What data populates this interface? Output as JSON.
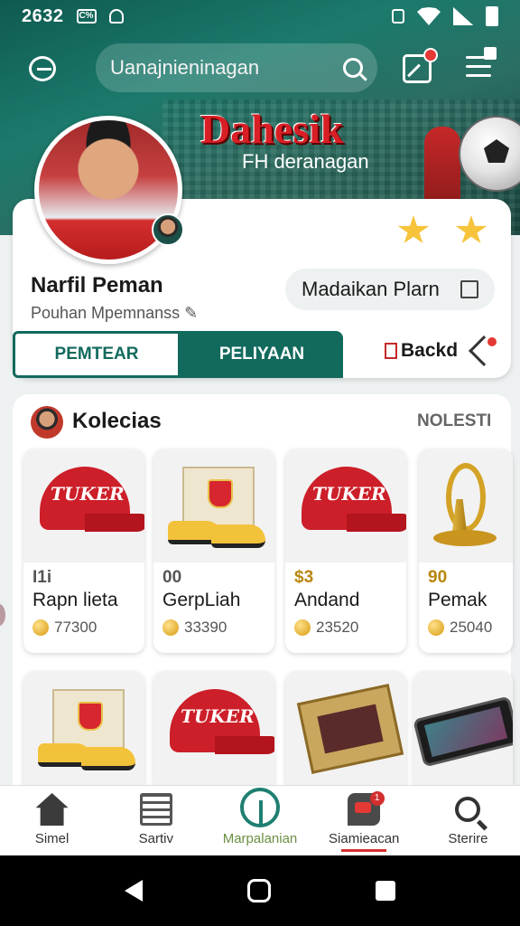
{
  "status_bar": {
    "time": "2632",
    "badge": "C%"
  },
  "header": {
    "search_placeholder": "Uanajnieninagan",
    "brand_title": "Dahesik",
    "brand_subtitle": "FH deranagan"
  },
  "profile": {
    "name": "Narfil Peman",
    "subtitle": "Pouhan Mpemnanss",
    "action_label": "Madaikan Plarn",
    "tabs": [
      {
        "label": "PEMTEAR",
        "active": true
      },
      {
        "label": "PELIYAAN",
        "active": false
      }
    ],
    "back_label": "Backd"
  },
  "collection": {
    "title": "Kolecias",
    "more": "NOLESTI",
    "items": [
      {
        "tag": "I1i",
        "title": "Rapn lieta",
        "price": "77300",
        "icon": "red-cap"
      },
      {
        "tag": "00",
        "title": "GerpLiah",
        "price": "33390",
        "icon": "football-boots"
      },
      {
        "tag": "$3",
        "title": "Andand",
        "price": "23520",
        "icon": "red-cap"
      },
      {
        "tag": "90",
        "title": "Pemak",
        "price": "25040",
        "icon": "gold-horn"
      }
    ],
    "row2_icons": [
      "football-boots",
      "red-cap",
      "book",
      "smartphone"
    ],
    "cap_logo": "TUKER"
  },
  "bottom_nav": [
    {
      "label": "Simel",
      "icon": "home-icon"
    },
    {
      "label": "Sartiv",
      "icon": "list-icon"
    },
    {
      "label": "Marpalanian",
      "icon": "market-icon",
      "active": true
    },
    {
      "label": "Siamieacan",
      "icon": "chat-icon",
      "badge": "1"
    },
    {
      "label": "Sterire",
      "icon": "search-icon"
    }
  ],
  "colors": {
    "brand_teal": "#126a5d",
    "brand_red": "#d81f26",
    "accent_gold": "#f6c33b"
  }
}
